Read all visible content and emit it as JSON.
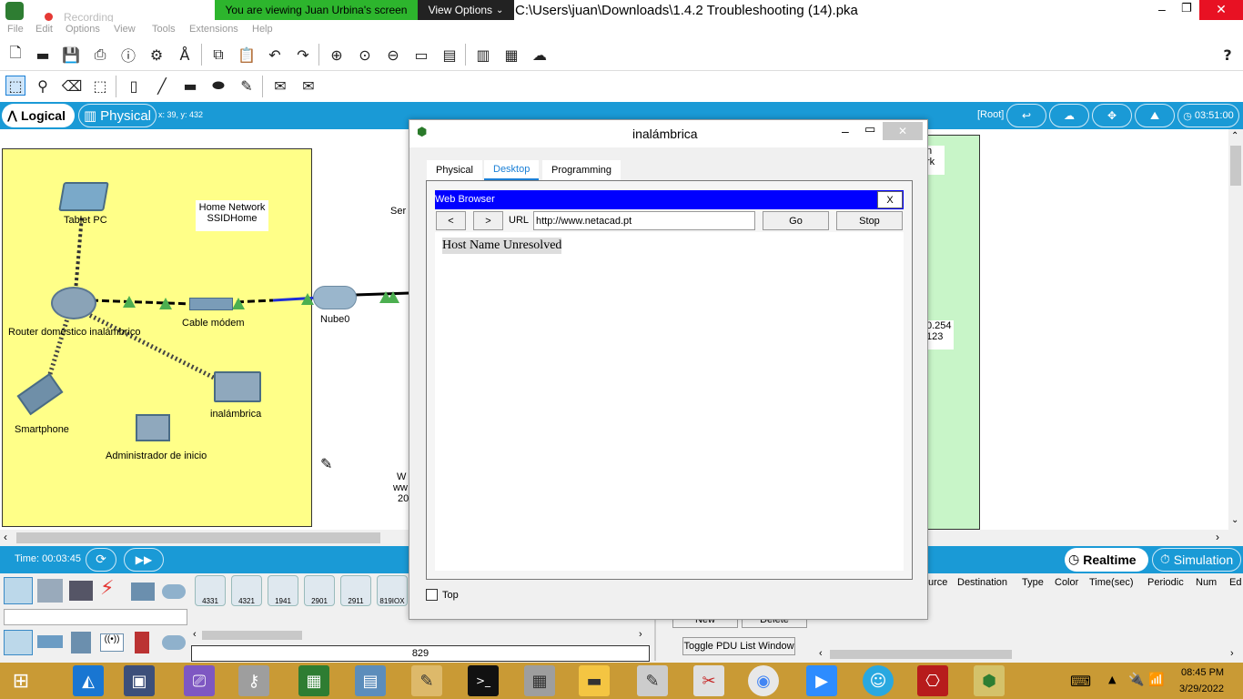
{
  "banner": {
    "viewing": "You are viewing Juan Urbina's screen",
    "view_options": "View Options",
    "recording": "Recording"
  },
  "window": {
    "path": "C:\\Users\\juan\\Downloads\\1.4.2 Troubleshooting (14).pka",
    "help": "?"
  },
  "menu": [
    "File",
    "Edit",
    "Options",
    "View",
    "Tools",
    "Extensions",
    "Help"
  ],
  "modebar": {
    "logical": "Logical",
    "physical": "Physical",
    "coords": "x: 39, y: 432",
    "root": "[Root]",
    "clock": "03:51:00"
  },
  "canvas": {
    "devices": {
      "tablet": "Tablet PC",
      "router": "Router doméstico inalámbrico",
      "cable_modem": "Cable módem",
      "cloud": "Nube0",
      "smartphone": "Smartphone",
      "laptop": "inalámbrica",
      "admin": "Administrador de inicio"
    },
    "note": {
      "line1": "Home Network",
      "line2": "SSIDHome"
    },
    "partial": {
      "ser": "Ser",
      "w1": "W",
      "w2": "ww",
      "w3": "20",
      "g1": "n",
      "g2": "rk",
      "g3": "0.254",
      "g4": "123"
    }
  },
  "timebar": {
    "time": "Time: 00:03:45",
    "realtime": "Realtime",
    "simulation": "Simulation"
  },
  "dialog": {
    "title": "inalámbrica",
    "tabs": [
      "Physical",
      "Desktop",
      "Programming"
    ],
    "browser": {
      "title": "Web Browser",
      "close": "X",
      "back": "<",
      "forward": ">",
      "url_label": "URL",
      "url_value": "http://www.netacad.pt",
      "go": "Go",
      "stop": "Stop",
      "message": "Host Name Unresolved"
    },
    "top_label": "Top"
  },
  "bottom": {
    "routers": [
      "4331",
      "4321",
      "1941",
      "2901",
      "2911",
      "819IOX"
    ],
    "count": "829",
    "new": "New",
    "delete": "Delete",
    "toggle": "Toggle PDU List Window",
    "columns": [
      "urce",
      "Destination",
      "Type",
      "Color",
      "Time(sec)",
      "Periodic",
      "Num",
      "Ed"
    ]
  },
  "taskbar": {
    "time": "08:45 PM",
    "date": "3/29/2022"
  }
}
